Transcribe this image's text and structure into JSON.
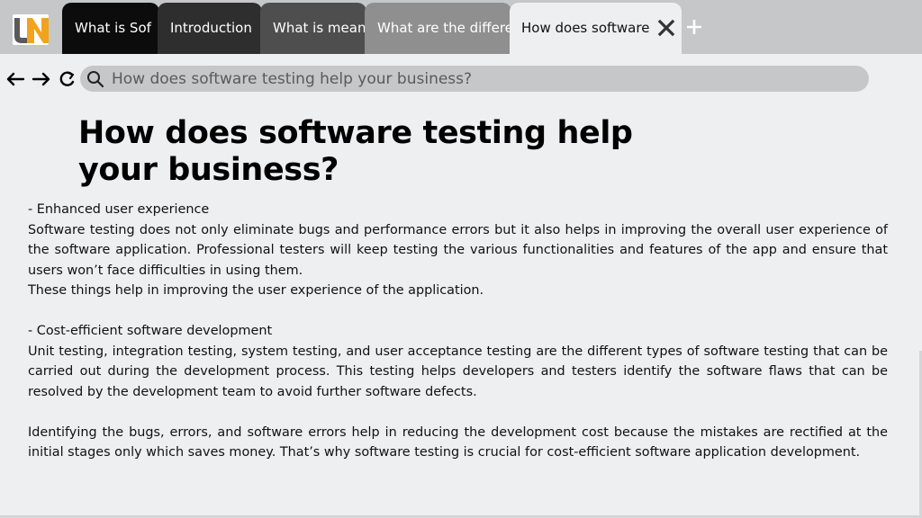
{
  "browser": {
    "tabs": [
      {
        "label": "What is Sof"
      },
      {
        "label": "Introduction"
      },
      {
        "label": "What is meant"
      },
      {
        "label": "What are the differen"
      },
      {
        "label": "How does software"
      }
    ],
    "new_tab_icon": "plus-icon",
    "close_tab_icon": "close-icon",
    "address": {
      "placeholder": "How does software testing help your business?"
    },
    "nav_icons": [
      "arrow-left-icon",
      "arrow-right-icon",
      "refresh-icon",
      "search-icon"
    ]
  },
  "logo": {
    "text": "UN",
    "colors": {
      "u": "#5a5a5a",
      "n": "#f2a31b",
      "bg": "#ffffff"
    }
  },
  "page": {
    "title_line1": "How does software testing help",
    "title_line2": "your business?",
    "paragraphs": [
      "- Enhanced user experience",
      "Software testing does not only eliminate bugs and performance errors but it also helps in improving the overall user experience of the software application. Professional testers will keep testing the various functionalities and features of the app and ensure that users won’t face difficulties in using them.",
      "These things help in improving the user experience of the application.",
      "- Cost-efficient software development",
      "Unit testing, integration testing, system testing, and user acceptance testing are the different types of software testing that can be carried out during the development process. This testing helps developers and testers identify the software flaws that can be resolved by the development team to avoid further software defects.",
      "Identifying the bugs, errors, and software errors help in reducing the development cost because the mistakes are rectified at the initial stages only which saves money. That’s why software testing is crucial for cost-efficient software application development."
    ]
  },
  "colors": {
    "page_bg": "#eeeff1",
    "tabbar_bg": "#c6c7c9",
    "tab1": "#0c0c0c",
    "tab2": "#2e2e2e",
    "tab3": "#4e4e4e",
    "tab4": "#8f8f8f",
    "accent": "#f2a31b"
  }
}
